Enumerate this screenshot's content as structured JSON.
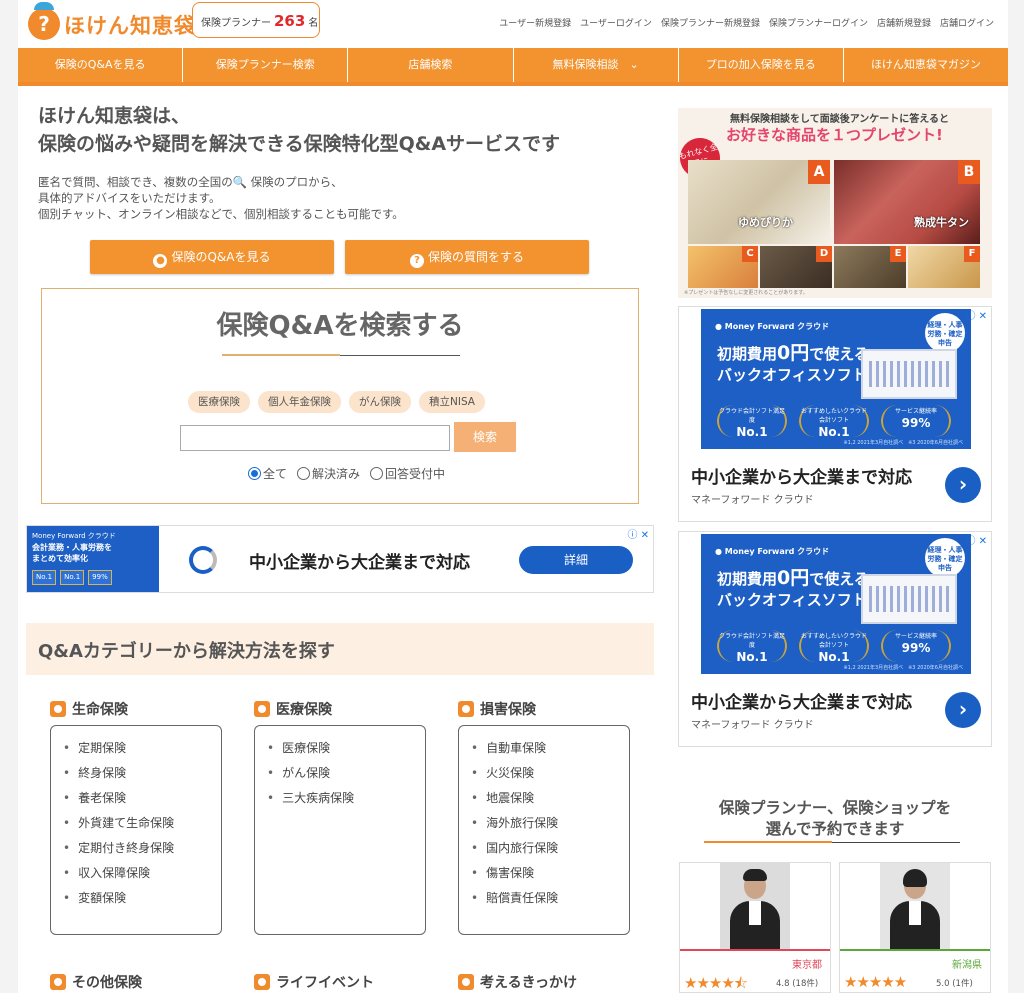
{
  "header": {
    "logo_badge": "?",
    "logo_text": "ほけん知恵袋",
    "planner_label": "保険プランナー",
    "planner_count": "263",
    "planner_unit": "名",
    "links": [
      "ユーザー新規登録",
      "ユーザーログイン",
      "保険プランナー新規登録",
      "保険プランナーログイン",
      "店舗新規登録",
      "店舗ログイン"
    ]
  },
  "nav": [
    "保険のQ&Aを見る",
    "保険プランナー検索",
    "店舗検索",
    "無料保険相談　⌄",
    "プロの加入保険を見る",
    "ほけん知恵袋マガジン"
  ],
  "hero": {
    "title1": "ほけん知恵袋は、",
    "title2": "保険の悩みや疑問を解決できる保険特化型Q&Aサービスです",
    "desc1": "匿名で質問、相談でき、複数の全国の🔍 保険のプロから、",
    "desc2": "具体的アドバイスをいただけます。",
    "desc3": "個別チャット、オンライン相談などで、個別相談することも可能です。",
    "btn_view": "保険のQ&Aを見る",
    "btn_ask": "保険の質問をする"
  },
  "search": {
    "title": "保険Q&Aを検索する",
    "tags": [
      "医療保険",
      "個人年金保険",
      "がん保険",
      "積立NISA"
    ],
    "input_value": "",
    "button": "検索",
    "radios": [
      {
        "label": "全て",
        "checked": true
      },
      {
        "label": "解決済み",
        "checked": false
      },
      {
        "label": "回答受付中",
        "checked": false
      }
    ]
  },
  "wide_ad": {
    "img_l1": "Money Forward クラウド",
    "img_l2": "会計業務・人事労務を",
    "img_l3": "まとめて効率化",
    "awards": [
      "No.1",
      "No.1",
      "99%"
    ],
    "text": "中小企業から大企業まで対応",
    "button": "詳細",
    "x": "ⓘ ✕"
  },
  "categories": {
    "heading": "Q&Aカテゴリーから解決方法を探す",
    "groups": [
      {
        "title": "生命保険",
        "items": [
          "定期保険",
          "終身保険",
          "養老保険",
          "外貨建て生命保険",
          "定期付き終身保険",
          "収入保障保険",
          "変額保険"
        ]
      },
      {
        "title": "医療保険",
        "items": [
          "医療保険",
          "がん保険",
          "三大疾病保険"
        ]
      },
      {
        "title": "損害保険",
        "items": [
          "自動車保険",
          "火災保険",
          "地震保険",
          "海外旅行保険",
          "国内旅行保険",
          "傷害保険",
          "賠償責任保険"
        ]
      }
    ],
    "bottom": [
      "その他保険",
      "ライフイベント",
      "考えるきっかけ"
    ]
  },
  "present_ad": {
    "line1": "無料保険相談をして面談後アンケートに答えると",
    "line2": "お好きな商品を１つプレゼント!",
    "ribbon": "もれなく全員に",
    "letters": [
      "A",
      "B",
      "C",
      "D",
      "E",
      "F"
    ],
    "cap_a": "ゆめぴりか",
    "cap_b": "熟成牛タン",
    "note": "※プレゼントは予告なしに変更されることがあります。"
  },
  "side_ads": [
    {
      "brand": "● Money Forward クラウド",
      "head_a": "初期費用",
      "head_b": "0円",
      "head_c": "で使える",
      "head2": "バックオフィスソフト",
      "badge": "経理・人事労務・確定申告",
      "awards": [
        {
          "small": "クラウド会計ソフト満足度",
          "big": "No.1"
        },
        {
          "small": "おすすめしたいクラウド会計ソフト",
          "big": "No.1"
        },
        {
          "small": "サービス継続率",
          "big": "99%"
        }
      ],
      "fine": "※1,2 2021年3月自社調べ　※3 2020年6月自社調べ",
      "main": "中小企業から大企業まで対応",
      "sub": "マネーフォワード クラウド",
      "x": "ⓘ ✕"
    },
    {
      "brand": "● Money Forward クラウド",
      "head_a": "初期費用",
      "head_b": "0円",
      "head_c": "で使える",
      "head2": "バックオフィスソフト",
      "badge": "経理・人事労務・確定申告",
      "awards": [
        {
          "small": "クラウド会計ソフト満足度",
          "big": "No.1"
        },
        {
          "small": "おすすめしたいクラウド会計ソフト",
          "big": "No.1"
        },
        {
          "small": "サービス継続率",
          "big": "99%"
        }
      ],
      "fine": "※1,2 2021年3月自社調べ　※3 2020年6月自社調べ",
      "main": "中小企業から大企業まで対応",
      "sub": "マネーフォワード クラウド",
      "x": "ⓘ ✕"
    }
  ],
  "selection": {
    "title1": "保険プランナー、保険ショップを",
    "title2": "選んで予約できます",
    "cards": [
      {
        "location": "東京都",
        "stars": "★★★★⯪",
        "rating": "4.8",
        "count": "(18件)",
        "color": "#e0485a"
      },
      {
        "location": "新潟県",
        "stars": "★★★★★",
        "rating": "5.0",
        "count": "(1件)",
        "color": "#5aa83a"
      }
    ]
  },
  "colors": {
    "accent": "#f29330",
    "ad_blue": "#1d5fc4"
  }
}
